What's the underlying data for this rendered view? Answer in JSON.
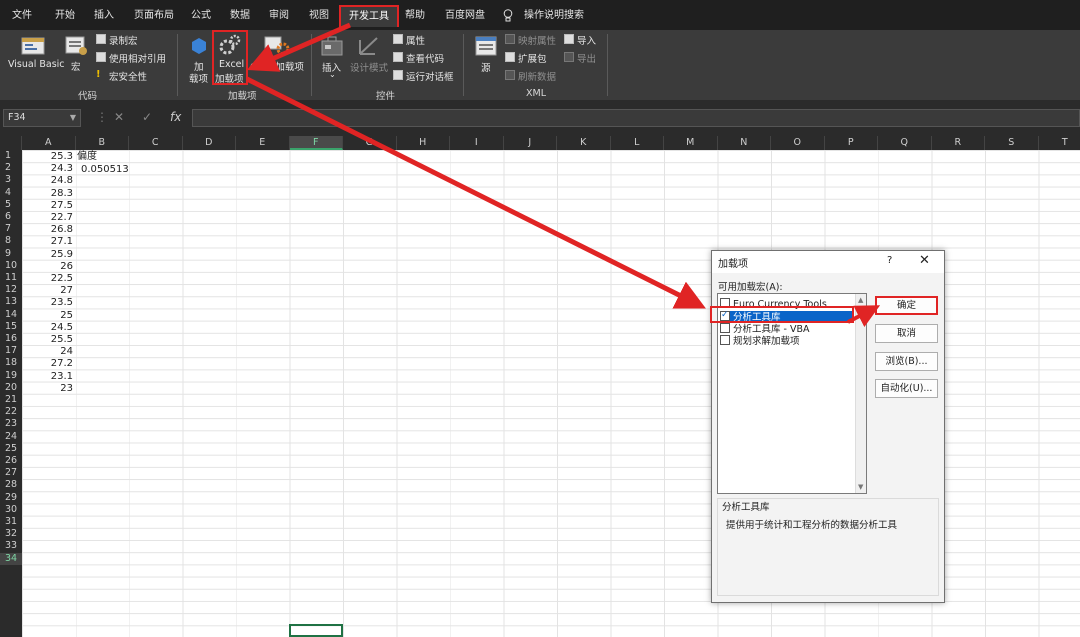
{
  "menu": {
    "tabs": [
      "文件",
      "开始",
      "插入",
      "页面布局",
      "公式",
      "数据",
      "审阅",
      "视图",
      "开发工具",
      "帮助",
      "百度网盘"
    ],
    "active": "开发工具",
    "search": "操作说明搜索"
  },
  "ribbon": {
    "code": {
      "vb": "Visual Basic",
      "macro": "宏",
      "record": "录制宏",
      "relative": "使用相对引用",
      "security": "宏安全性",
      "group": "代码"
    },
    "addins": {
      "addins_l1": "加",
      "addins_l2": "载项",
      "excel_l1": "Excel",
      "excel_l2": "加载项",
      "com": "COM 加载项",
      "group": "加载项"
    },
    "controls": {
      "insert": "插入",
      "design": "设计模式",
      "props": "属性",
      "viewcode": "查看代码",
      "rundialog": "运行对话框",
      "group": "控件"
    },
    "xml": {
      "source": "源",
      "mapprops": "映射属性",
      "expansion": "扩展包",
      "refresh": "刷新数据",
      "import": "导入",
      "export": "导出",
      "group": "XML"
    }
  },
  "formula_bar": {
    "name_box": "F34",
    "fx": "fx",
    "cancel": "✕",
    "enter": "✓"
  },
  "columns": [
    "A",
    "B",
    "C",
    "D",
    "E",
    "F",
    "G",
    "H",
    "I",
    "J",
    "K",
    "L",
    "M",
    "N",
    "O",
    "P",
    "Q",
    "R",
    "S",
    "T"
  ],
  "selected_column": "F",
  "rows": [
    "1",
    "2",
    "3",
    "4",
    "5",
    "6",
    "7",
    "8",
    "9",
    "10",
    "11",
    "12",
    "13",
    "14",
    "15",
    "16",
    "17",
    "18",
    "19",
    "20",
    "21",
    "22",
    "23",
    "24",
    "25",
    "26",
    "27",
    "28",
    "29",
    "30",
    "31",
    "32",
    "33",
    "34"
  ],
  "selected_row": "34",
  "sheet": {
    "col_a": [
      "25.3",
      "24.3",
      "24.8",
      "28.3",
      "27.5",
      "22.7",
      "26.8",
      "27.1",
      "25.9",
      "26",
      "22.5",
      "27",
      "23.5",
      "25",
      "24.5",
      "25.5",
      "24",
      "27.2",
      "23.1",
      "23"
    ],
    "b1": "偏度",
    "b2": "0.050513"
  },
  "dialog": {
    "title": "加载项",
    "help": "?",
    "close": "✕",
    "list_label": "可用加载宏(A):",
    "items": [
      {
        "label": "Euro Currency Tools",
        "checked": false
      },
      {
        "label": "分析工具库",
        "checked": true
      },
      {
        "label": "分析工具库 - VBA",
        "checked": false
      },
      {
        "label": "规划求解加载项",
        "checked": false
      }
    ],
    "buttons": {
      "ok": "确定",
      "cancel": "取消",
      "browse": "浏览(B)...",
      "automation": "自动化(U)..."
    },
    "desc_title": "分析工具库",
    "desc_text": "提供用于统计和工程分析的数据分析工具"
  },
  "colors": {
    "accent_red": "#e02424",
    "selection_blue": "#0a64c8",
    "excel_green": "#1f7244"
  }
}
